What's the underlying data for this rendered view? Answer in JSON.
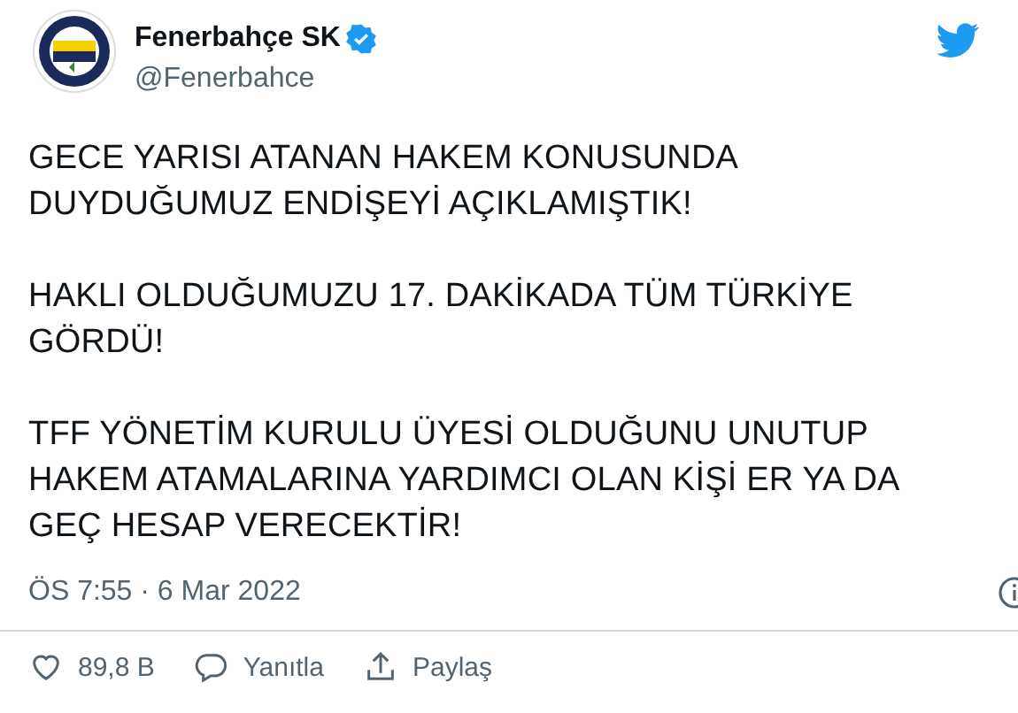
{
  "author": {
    "name": "Fenerbahçe SK",
    "verified": true,
    "handle": "@Fenerbahce"
  },
  "paragraphs": [
    {
      "lines": [
        "GECE YARISI ATANAN HAKEM KONUSUNDA",
        "DUYDUĞUMUZ ENDİŞEYİ AÇIKLAMIŞTIK!"
      ]
    },
    {
      "lines": [
        "HAKLI OLDUĞUMUZU 17. DAKİKADA TÜM TÜRKİYE",
        "GÖRDÜ!"
      ]
    },
    {
      "lines": [
        "TFF YÖNETİM KURULU ÜYESİ OLDUĞUNU UNUTUP",
        "HAKEM ATAMALARINA YARDIMCI OLAN KİŞİ ER YA DA",
        "GEÇ HESAP VERECEKTİR!"
      ]
    }
  ],
  "timestamp": "ÖS 7:55 · 6 Mar 2022",
  "actions": [
    {
      "kind": "like",
      "label": "89,8 B"
    },
    {
      "kind": "reply",
      "label": "Yanıtla"
    },
    {
      "kind": "share",
      "label": "Paylaş"
    }
  ]
}
